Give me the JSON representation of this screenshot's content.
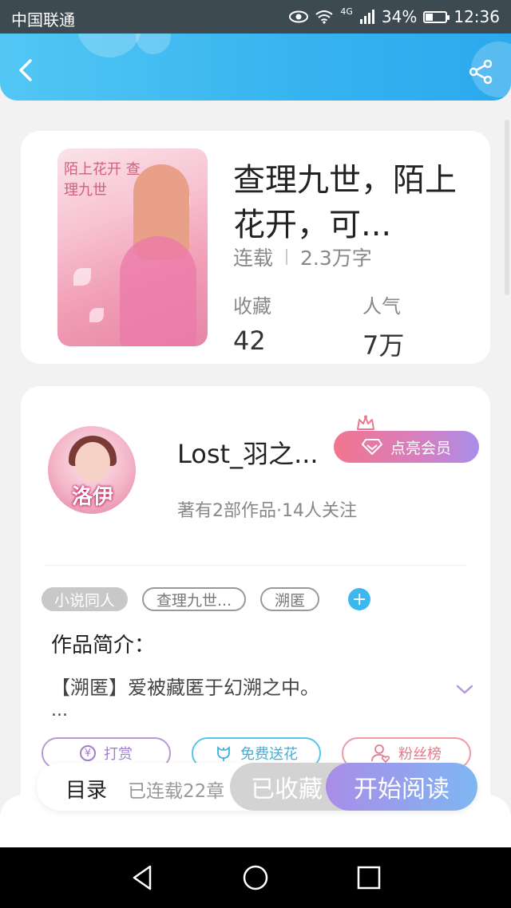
{
  "status_bar": {
    "carrier": "中国联通",
    "network": "4G",
    "battery": "34%",
    "battery_level": 0.34,
    "time": "12:36"
  },
  "header": {
    "back_icon": "chevron-left-icon",
    "share_icon": "share-icon"
  },
  "book": {
    "title": "查理九世，陌上花开，可...",
    "status": "连载",
    "word_count": "2.3万字",
    "favorites_label": "收藏",
    "favorites_value": "42",
    "popularity_label": "人气",
    "popularity_value": "7万",
    "cover_text": "陌上花开 查理九世"
  },
  "author": {
    "name": "Lost_羽之...",
    "avatar_text": "洛伊",
    "vip_label": "点亮会员",
    "stats": "著有2部作品·14人关注"
  },
  "tags": [
    "小说同人",
    "查理九世...",
    "溯匿"
  ],
  "intro": {
    "heading": "作品简介：",
    "text": "【溯匿】爱被藏匿于幻溯之中。",
    "ellipsis": "..."
  },
  "actions": {
    "reward": "打赏",
    "reward_glyph": "¥",
    "flower": "免费送花",
    "fans": "粉丝榜"
  },
  "bottom_bar": {
    "catalog": "目录",
    "chapters": "已连载22章",
    "collected": "已收藏",
    "start_reading": "开始阅读"
  },
  "colors": {
    "header": "#36b3ef",
    "accent_purple": "#a98de8",
    "vip_pink": "#f2758f"
  }
}
